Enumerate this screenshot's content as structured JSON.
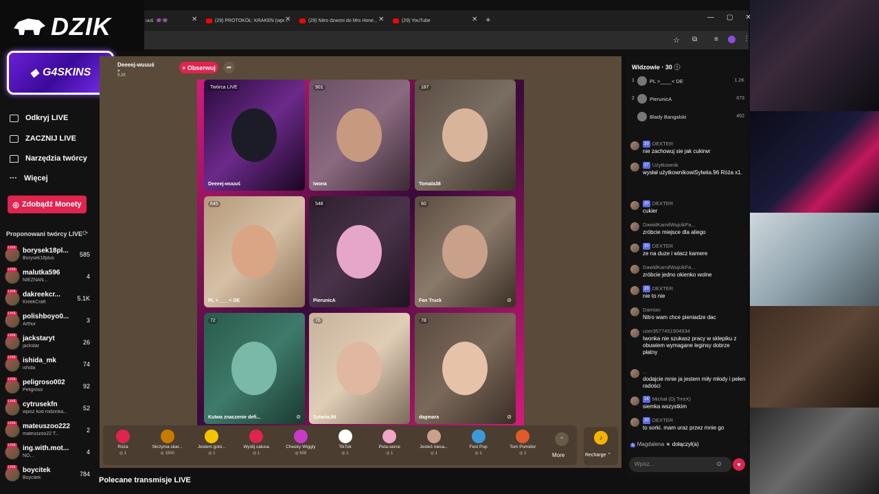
{
  "overlay": {
    "brand": "DZIK",
    "sponsor": "G4SKINS"
  },
  "nav": [
    {
      "label": "Odkryj LIVE"
    },
    {
      "label": "ZACZNIJ LIVE"
    },
    {
      "label": "Narzędzia twórcy"
    },
    {
      "label": "Więcej"
    }
  ],
  "coins_button": "Zdobądź Monety",
  "suggested": {
    "title": "Proponowani twórcy LIVE",
    "creators": [
      {
        "name": "borysek18pl...",
        "sub": "Borysek18plus",
        "count": "585"
      },
      {
        "name": "malutka596",
        "sub": "NIEZNAN...",
        "count": "4"
      },
      {
        "name": "dakreekcr...",
        "sub": "KreekCraft",
        "count": "5.1K"
      },
      {
        "name": "polishboyo0...",
        "sub": "Arthur",
        "count": "3"
      },
      {
        "name": "jackstaryt",
        "sub": "jackstar",
        "count": "26"
      },
      {
        "name": "ishida_mk",
        "sub": "ishida",
        "count": "74"
      },
      {
        "name": "peligroso002",
        "sub": "Peligroso",
        "count": "92"
      },
      {
        "name": "cytrusekfn",
        "sub": "wpisz kod rodzinka...",
        "count": "52"
      },
      {
        "name": "mateuszoo222",
        "sub": "mateuszoo22 T...",
        "count": "2"
      },
      {
        "name": "ing.with.mot...",
        "sub": "NO...",
        "count": "4"
      },
      {
        "name": "boycitek",
        "sub": "Boycitek",
        "count": "784"
      }
    ]
  },
  "tabs": [
    {
      "label": "(29) PROTOKÓŁ: KRAKEN (wpr..."
    },
    {
      "label": "(29) Nitro dzwoni do Mrs Hone..."
    },
    {
      "label": "(29) YouTube"
    }
  ],
  "tab_partial": "uuś",
  "host": {
    "name": "Deeeej-wuuuś",
    "viewers": "9,3K",
    "follow": "+ Obserwuj"
  },
  "cells": [
    {
      "count": "Twórca LIVE",
      "caption": "Deeeej-wuuuś"
    },
    {
      "count": "901",
      "caption": "Iwona"
    },
    {
      "count": "187",
      "caption": "Tomala38"
    },
    {
      "count": "645",
      "caption": "PL >____< DE"
    },
    {
      "count": "548",
      "caption": "PierunicA"
    },
    {
      "count": "60",
      "caption": "Fan Truck"
    },
    {
      "count": "72",
      "caption": "Kutwa znaczenie defi..."
    },
    {
      "count": "76",
      "caption": "Sylwiia.96"
    },
    {
      "count": "78",
      "caption": "dagmara"
    }
  ],
  "gifts": [
    {
      "name": "Róża",
      "price": "1"
    },
    {
      "name": "Skrzynia skar...",
      "price": "1500"
    },
    {
      "name": "Jestem goto...",
      "price": "1"
    },
    {
      "name": "Wyślij całusa",
      "price": "1"
    },
    {
      "name": "Cheeky Wiggly",
      "price": "500"
    },
    {
      "name": "TikTok",
      "price": "1"
    },
    {
      "name": "Puta-serce",
      "price": "1"
    },
    {
      "name": "Jesteś niesa...",
      "price": "1"
    },
    {
      "name": "Fest Pop",
      "price": "1"
    },
    {
      "name": "Tom Pomidor",
      "price": "1"
    }
  ],
  "more": "More",
  "recharge": "Recharge",
  "section_title": "Polecane transmisje LIVE",
  "viewers": {
    "title": "Widzowie · 30",
    "list": [
      {
        "rank": "1",
        "name": "PL >____< DE",
        "score": "1.2K"
      },
      {
        "rank": "2",
        "name": "PierunicA",
        "score": "673"
      },
      {
        "rank": "",
        "name": "Blady Bangalski",
        "score": "402"
      }
    ]
  },
  "messages": [
    {
      "user": "DEXTER",
      "badge": "20",
      "text": "nie zachowuj sie jak cukirwr"
    },
    {
      "user": "Użytkownik",
      "badge": "27",
      "text": "wysłał użytkownikowiSylwiia.96 Róża x1."
    },
    {
      "user": "DEXTER",
      "badge": "20",
      "text": "cukier"
    },
    {
      "user": "DawidKamilWujcikFa...",
      "badge": "",
      "text": "zróbcie miejsce dla aliego"
    },
    {
      "user": "DEXTER",
      "badge": "20",
      "text": "ze na duze i wlacz kamere"
    },
    {
      "user": "DawidKamilWujcikFa...",
      "badge": "",
      "text": "zróbcie jedno okienko wolne"
    },
    {
      "user": "DEXTER",
      "badge": "20",
      "text": "nie to nie"
    },
    {
      "user": "Damian",
      "badge": "",
      "text": "Nitro wam chce pieniadze dac"
    },
    {
      "user": "user3577451904934",
      "badge": "",
      "text": "Iwonka nie szukasz pracy w sklepiku z obuwiem wymagane leginsy dobrze płatny"
    },
    {
      "user": "...",
      "badge": "",
      "text": "dodajcie mnie ja jestem miły młody i pełen radości"
    },
    {
      "user": "Michał (Dj TrreX)",
      "badge": "14",
      "text": "siemka wszystkim"
    },
    {
      "user": "DEXTER",
      "badge": "20",
      "text": "to sorki. mam uraz przez mnie go"
    }
  ],
  "joined": {
    "user": "Magdalena",
    "text": "dołączył(a)"
  },
  "input_placeholder": "Wpisz..."
}
